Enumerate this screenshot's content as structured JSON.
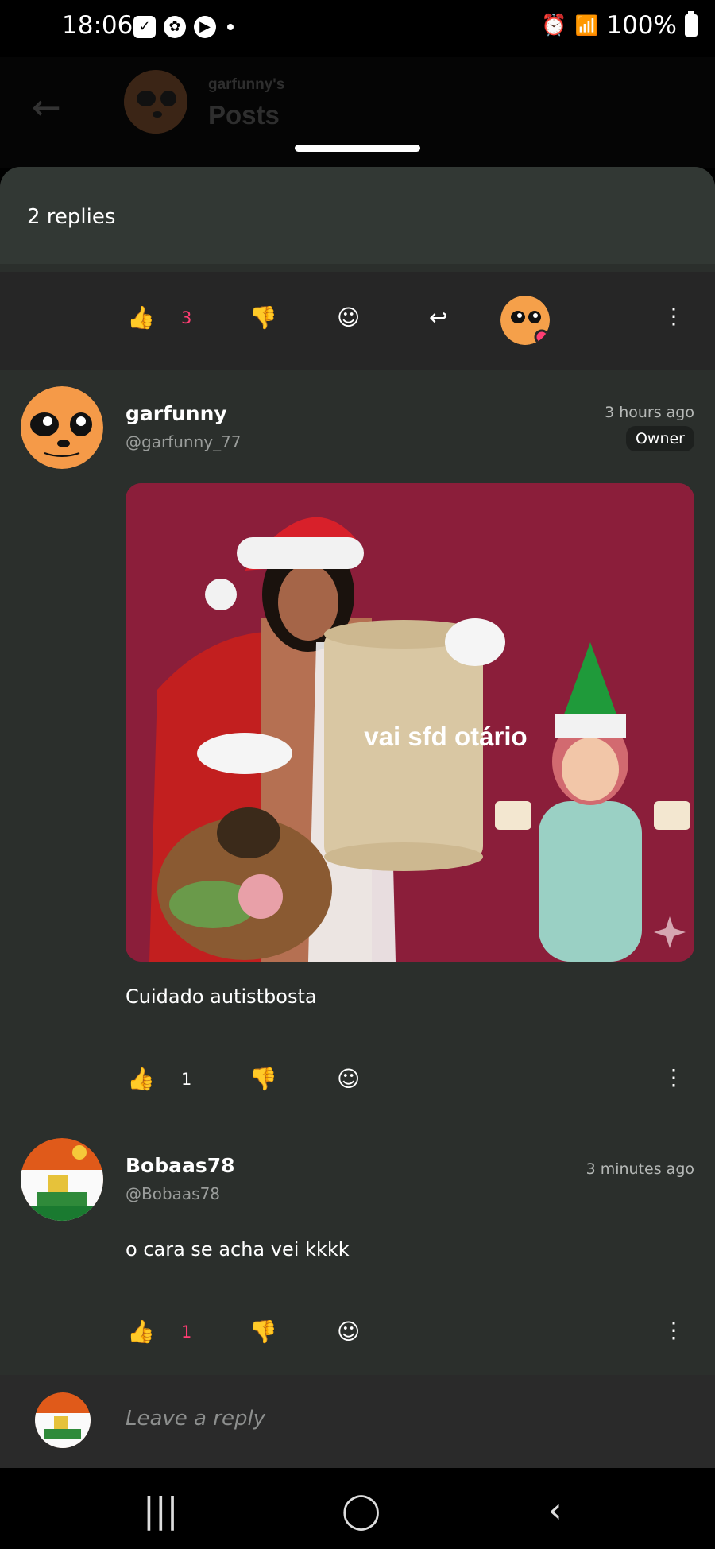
{
  "status_bar": {
    "time": "18:06",
    "battery": "100%"
  },
  "appbar": {
    "subtitle": "garfunny's",
    "title": "Posts"
  },
  "replies_header": {
    "title": "2 replies"
  },
  "parent_post_actions": {
    "like_count": "3"
  },
  "comments": [
    {
      "name": "garfunny",
      "handle": "@garfunny_77",
      "time": "3 hours ago",
      "badge": "Owner",
      "image_caption": "vai sfd otário",
      "body": "Cuidado autistbosta",
      "like_count": "1"
    },
    {
      "name": "Bobaas78",
      "handle": "@Bobaas78",
      "time": "3 minutes ago",
      "body": "o cara se acha vei kkkk",
      "like_count": "1"
    }
  ],
  "reply_bar": {
    "placeholder": "Leave a reply"
  },
  "colors": {
    "accent": "#ff3d73",
    "sheet": "#2b2f2c",
    "header": "#323834"
  }
}
